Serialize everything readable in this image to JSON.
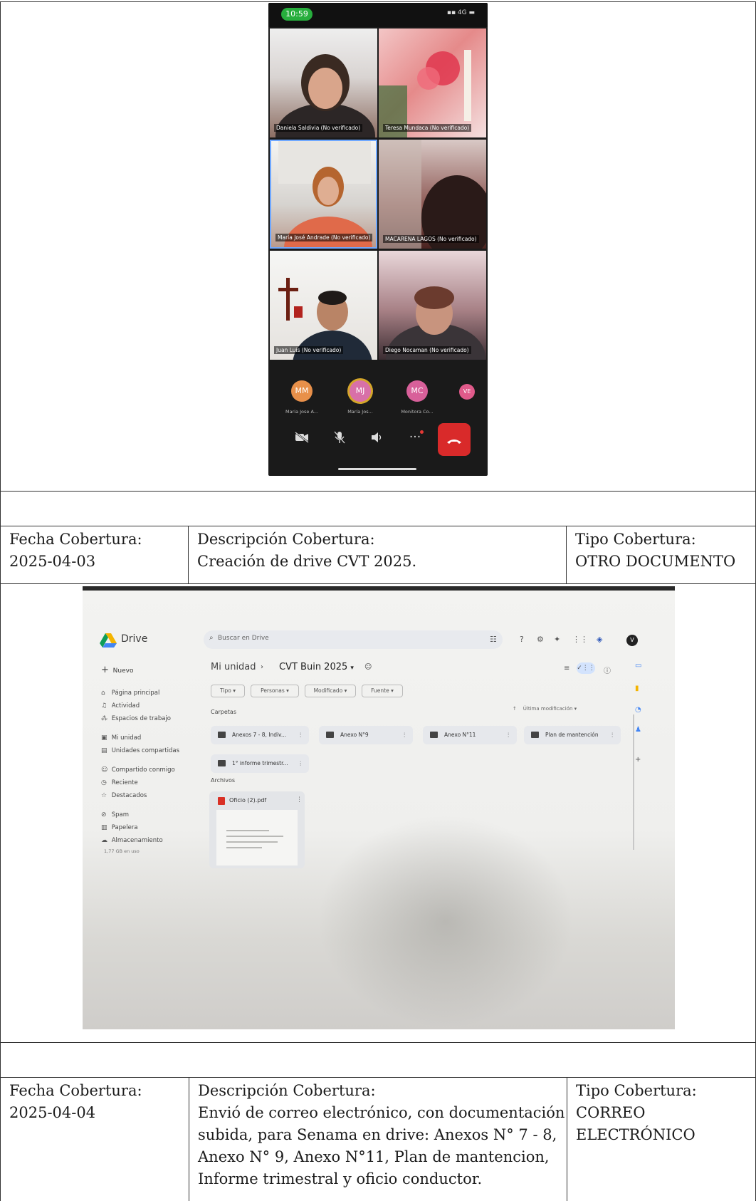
{
  "phone": {
    "time": "10:59",
    "network": "4G",
    "participants": [
      {
        "name": "Daniela Saldivia (No verificado)"
      },
      {
        "name": "Teresa Mundaca (No verificado)"
      },
      {
        "name": "María José Andrade (No verificado)"
      },
      {
        "name": "MACARENA LAGOS (No verificado)"
      },
      {
        "name": "Juan Luis (No verificado)"
      },
      {
        "name": "Diego Nocaman (No verificado)"
      }
    ],
    "avatars": [
      {
        "initials": "MM",
        "label": "Maria Jose A...",
        "color": "#e8904a"
      },
      {
        "initials": "MJ",
        "label": "María Jos...",
        "color": "#d870a8"
      },
      {
        "initials": "MC",
        "label": "Monitora Co...",
        "color": "#d8609a"
      },
      {
        "initials": "VE",
        "label": "",
        "color": "#e05a8a"
      }
    ],
    "controls": {
      "more": "···"
    }
  },
  "entries": [
    {
      "fecha_label": "Fecha Cobertura:",
      "fecha": "2025-04-03",
      "desc_label": "Descripción Cobertura:",
      "desc": "Creación de drive CVT 2025.",
      "tipo_label": "Tipo Cobertura:",
      "tipo": "OTRO DOCUMENTO"
    },
    {
      "fecha_label": "Fecha Cobertura:",
      "fecha": "2025-04-04",
      "desc_label": "Descripción Cobertura:",
      "desc": "Envió de correo electrónico, con documentación\nsubida, para Senama en drive: Anexos N° 7 - 8,\nAnexo N° 9, Anexo N°11, Plan de mantencion,\nInforme trimestral y oficio conductor.",
      "tipo_label": "Tipo Cobertura:",
      "tipo": "CORREO\nELECTRÓNICO"
    }
  ],
  "drive": {
    "app_name": "Drive",
    "search_placeholder": "Buscar en Drive",
    "new_button": "Nuevo",
    "nav": [
      {
        "icon": "home-icon",
        "label": "Página principal"
      },
      {
        "icon": "bell-icon",
        "label": "Actividad"
      },
      {
        "icon": "workspaces-icon",
        "label": "Espacios de trabajo"
      },
      {
        "icon": "my-drive-icon",
        "label": "Mi unidad"
      },
      {
        "icon": "shared-drives-icon",
        "label": "Unidades compartidas"
      },
      {
        "icon": "shared-with-me-icon",
        "label": "Compartido conmigo"
      },
      {
        "icon": "clock-icon",
        "label": "Reciente"
      },
      {
        "icon": "star-icon",
        "label": "Destacados"
      },
      {
        "icon": "spam-icon",
        "label": "Spam"
      },
      {
        "icon": "trash-icon",
        "label": "Papelera"
      },
      {
        "icon": "cloud-icon",
        "label": "Almacenamiento"
      }
    ],
    "storage_used": "1,77 GB en uso",
    "breadcrumb": [
      "Mi unidad",
      "CVT Buin 2025"
    ],
    "filters": [
      "Tipo",
      "Personas",
      "Modificado",
      "Fuente"
    ],
    "sort_label": "Última modificación",
    "folders_label": "Carpetas",
    "folders": [
      "Anexos 7 - 8, Indiv...",
      "Anexo N°9",
      "Anexo N°11",
      "Plan de mantención",
      "1° informe trimestr..."
    ],
    "files_label": "Archivos",
    "files": [
      "Oficio (2).pdf"
    ]
  }
}
